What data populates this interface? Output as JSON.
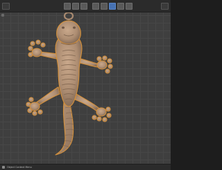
{
  "statusbar": {
    "text": "Object Context Menu",
    "icon": "mouse-icon"
  },
  "model": {
    "name": "lizard-pendant",
    "color": "#ad8d72"
  },
  "colors": {
    "header": "#2b2b2b",
    "viewport": "#404040",
    "grid": "#474747",
    "active_tool": "#4772b3"
  }
}
